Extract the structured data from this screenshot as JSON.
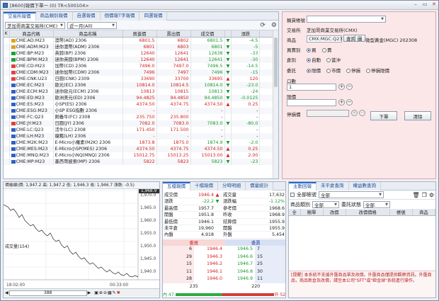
{
  "window": {
    "title": "[8600]報價下單一 (0) TR<500104>",
    "min": "–",
    "max": "▭",
    "close": "✕"
  },
  "quote_panel": {
    "tabs": [
      "交易所報價",
      "商品類別報價",
      "自選報價",
      "個價報T字報價",
      "四選報價"
    ],
    "exchange_select": "芝加哥商業交易所(CME)",
    "period_select": "近一月(All)",
    "columns": [
      "K",
      "商品代碼",
      "商品名稱",
      "買進價",
      "賣出價",
      "成交價",
      "",
      "漲跌",
      ""
    ],
    "rows": [
      {
        "code": "CME:AD:M23",
        "name": "澳幣(AD) 2306",
        "bid": "6801.5",
        "ask": "6802",
        "last": "6801.5",
        "arrow": "▼",
        "chg": "-4.5",
        "ind": "#e0a020",
        "c": "dn"
      },
      {
        "code": "CME:ADM:M23",
        "name": "迷你澳幣(ADM) 2306",
        "bid": "6801",
        "ask": "6803",
        "last": "6801",
        "arrow": "▼",
        "chg": "-5",
        "ind": "#e0a020",
        "c": "dn"
      },
      {
        "code": "CME:BP:M23",
        "name": "英鎊(BP) 2306",
        "bid": "12640",
        "ask": "12641",
        "last": "12638",
        "arrow": "▼",
        "chg": "-33",
        "ind": "#1aa036",
        "c": "dn"
      },
      {
        "code": "CME:BPM:M23",
        "name": "迷你英鎊(BPM) 2306",
        "bid": "12640",
        "ask": "12641",
        "last": "12641",
        "arrow": "▼",
        "chg": "-30",
        "ind": "#1aa036",
        "c": "dn"
      },
      {
        "code": "CME:CD:M23",
        "name": "加幣(CD) 2306",
        "bid": "7496.0",
        "ask": "7497.0",
        "last": "7496.5",
        "arrow": "▼",
        "chg": "-14.5",
        "ind": "#e04040",
        "c": "dn"
      },
      {
        "code": "CME:CDM:M23",
        "name": "迷你加幣(CDM) 2306",
        "bid": "7496",
        "ask": "7497",
        "last": "7496",
        "arrow": "▼",
        "chg": "-15",
        "ind": "#e04040",
        "c": "dn"
      },
      {
        "code": "CME:CNK:U23",
        "name": "日圓(CNK) 2309",
        "bid": "33690",
        "ask": "33700",
        "last": "33695",
        "arrow": "▲",
        "chg": "120",
        "ind": "#e04040",
        "c": "up"
      },
      {
        "code": "CME:EC:M23",
        "name": "歐元(EC) 2306",
        "bid": "10814.0",
        "ask": "10814.5",
        "last": "10814.0",
        "arrow": "▼",
        "chg": "-23.0",
        "ind": "#3060c0",
        "c": "dn"
      },
      {
        "code": "CME:ECM:M23",
        "name": "迷你歐元(ECM) 2306",
        "bid": "10813",
        "ask": "10815",
        "last": "10813",
        "arrow": "▼",
        "chg": "-24",
        "ind": "#3060c0",
        "c": "dn"
      },
      {
        "code": "CME:ED:M23",
        "name": "歐洲美元(ED) 2306",
        "bid": "94.4825",
        "ask": "94.4850",
        "last": "94.4850",
        "arrow": "▼",
        "chg": "-0.0125",
        "ind": "#3060c0",
        "c": "dn"
      },
      {
        "code": "CME:ES:M23",
        "name": "小SP(ES) 2306",
        "bid": "4374.50",
        "ask": "4374.75",
        "last": "4374.50",
        "arrow": "▲",
        "chg": "0.25",
        "ind": "#3060c0",
        "c": "up"
      },
      {
        "code": "CME:ESG:M23",
        "name": "小SP ESG指數 2306",
        "bid": "-",
        "ask": "-",
        "last": "-",
        "arrow": "",
        "chg": "-",
        "ind": "#3060c0",
        "c": ""
      },
      {
        "code": "CME:FC:Q23",
        "name": "飼養牛(FC) 2308",
        "bid": "235.750",
        "ask": "235.800",
        "last": "-",
        "arrow": "",
        "chg": "-",
        "ind": "#3060c0",
        "c": ""
      },
      {
        "code": "CME:JY:M23",
        "name": "日圓(JY) 2306",
        "bid": "7082.0",
        "ask": "7083.0",
        "last": "7083.0",
        "arrow": "▼",
        "chg": "-80.0",
        "ind": "#e04040",
        "c": "dn"
      },
      {
        "code": "CME:LC:Q23",
        "name": "活牛(LC) 2308",
        "bid": "171.450",
        "ask": "171.500",
        "last": "-",
        "arrow": "",
        "chg": "-",
        "ind": "#3060c0",
        "c": ""
      },
      {
        "code": "CME:LH:M23",
        "name": "瘦豬(LH) 2306",
        "bid": "-",
        "ask": "-",
        "last": "-",
        "arrow": "",
        "chg": "-",
        "ind": "#3060c0",
        "c": ""
      },
      {
        "code": "CME:M2K:M23",
        "name": "E-Micro小羅素(M2K) 2306",
        "bid": "1873.8",
        "ask": "1875.0",
        "last": "1874.9",
        "arrow": "▼",
        "chg": "-2.0",
        "ind": "#3060c0",
        "c": "dn"
      },
      {
        "code": "CME:MES:M23",
        "name": "E-Micro小SP(MES) 2306",
        "bid": "4374.50",
        "ask": "4374.75",
        "last": "4374.50",
        "arrow": "▲",
        "chg": "0.25",
        "ind": "#3060c0",
        "c": "up"
      },
      {
        "code": "CME:MNQ:M23",
        "name": "E-Micro小NQ(MNQ) 2306",
        "bid": "15012.75",
        "ask": "15013.25",
        "last": "15013.00",
        "arrow": "▲",
        "chg": "2.00",
        "ind": "#3060c0",
        "c": "up"
      },
      {
        "code": "CME:MP:M23",
        "name": "墨西哥披索(MP) 2306",
        "bid": "5822",
        "ask": "5823",
        "last": "5823",
        "arrow": "▼",
        "chg": "-23",
        "ind": "#3060c0",
        "c": "dn"
      }
    ]
  },
  "order_panel": {
    "account_label": "類貨帳號",
    "exchange_label": "交易所",
    "exchange_value": "芝加哥商業交易所(CMX)",
    "product_label": "商品",
    "product_value": "CMX:MGC:Q23",
    "product_desc": "微型黃金(MGC) 202308",
    "query_btn": "查詢",
    "chart_btn": "圖",
    "side_label": "買賣別",
    "buy": "買",
    "sell": "賣",
    "oc_label": "倉別",
    "auto": "自動",
    "daytrade": "當沖",
    "type_label": "委託",
    "limit": "限價",
    "market": "市價",
    "stop": "停損",
    "stoplimit": "停損限價",
    "qty_label": "口數",
    "qty_value": "1",
    "price_label": "限價",
    "stop_label": "停損價",
    "submit_btn": "下單",
    "clear_btn": "清除"
  },
  "chart": {
    "info": "價格線(價: 1,947.2 高: 1,947.2 低: 1,946.3 收: 1,946.7 漲跌: -0.5)",
    "yticks": [
      "1,970.0",
      "1,965.0",
      "1,960.0",
      "1,955.0",
      "1,950.0",
      "1,945.0",
      "1,940.0"
    ],
    "price_badge": "1,968.9",
    "volume_label": "成交量(154)",
    "xticks": [
      "18:02:00",
      "",
      "00:33:00"
    ],
    "scroll_value": "388"
  },
  "detail": {
    "tabs": [
      "五檔報價",
      "十檔報價",
      "分時明細",
      "價量統計"
    ],
    "left": [
      [
        "成交價",
        "1946.4",
        "▲"
      ],
      [
        "漲跌",
        "-22.2",
        "▼"
      ],
      [
        "最高價",
        "1957.7",
        ""
      ],
      [
        "開盤",
        "1951.8",
        ""
      ],
      [
        "最低價",
        "1946.1",
        ""
      ],
      [
        "未平倉",
        "19,960",
        ""
      ],
      [
        "內盤",
        "4,918",
        ""
      ]
    ],
    "right": [
      [
        "成交量",
        "17,632"
      ],
      [
        "漲跌幅",
        "-1.12%"
      ],
      [
        "參考價",
        "1968.6"
      ],
      [
        "昨收",
        "1968.9"
      ],
      [
        "結算價",
        "1955.9"
      ],
      [
        "開盤",
        "1955.9"
      ],
      [
        "外盤",
        "5,454"
      ]
    ],
    "book_header_bid": "委買",
    "book_header_ask": "委賣",
    "book": [
      {
        "bq": "6",
        "bp": "1946.4",
        "ap": "1946.5",
        "aq": "7"
      },
      {
        "bq": "29",
        "bp": "1946.3",
        "ap": "1946.6",
        "aq": "15"
      },
      {
        "bq": "15",
        "bp": "1946.2",
        "ap": "1946.7",
        "aq": "25"
      },
      {
        "bq": "11",
        "bp": "1946.1",
        "ap": "1946.8",
        "aq": "30"
      },
      {
        "bq": "28",
        "bp": "1946.0",
        "ap": "1946.9",
        "aq": "11"
      }
    ],
    "book_total_bid": "235",
    "book_total_ask": "220",
    "inner": "內 47.",
    "outer": "外 52."
  },
  "main": {
    "tabs": [
      "主動回報",
      "未平倉查詢",
      "權益數查詢"
    ],
    "all_label": "全部帳號",
    "all_value": "全部",
    "cat_label": "商品類別",
    "cat_value": "全部",
    "status_label": "委託狀態",
    "status_value": "全部",
    "columns": [
      "全",
      "刪單",
      "改價",
      "改價價格",
      "帳號",
      "商品"
    ],
    "notice": "[提醒] 本系統不支援外匯商品單及改價。外匯商品僅提供觀察資訊。外匯商品，商品新倉及改價，請至本公司\"SFT\"或\"鉅金球\"系統進行操作。"
  }
}
